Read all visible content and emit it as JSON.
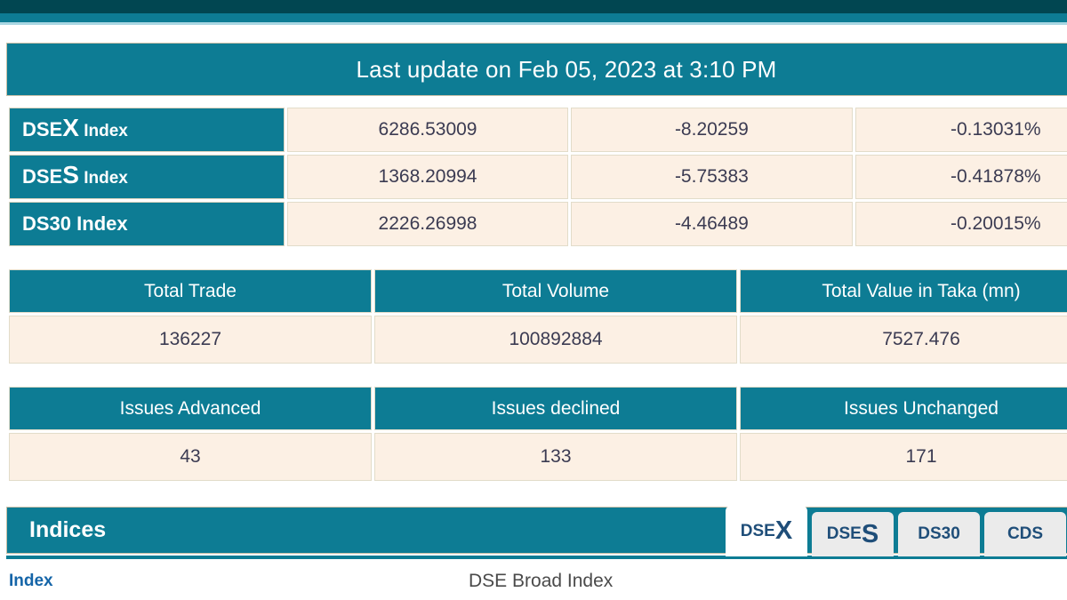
{
  "banner": {
    "last_update": "Last update on Feb 05, 2023 at 3:10 PM"
  },
  "indices": [
    {
      "prefix": "DSE",
      "emphasis": "X",
      "suffix": " Index",
      "value": "6286.53009",
      "change": "-8.20259",
      "percent": "-0.13031%"
    },
    {
      "prefix": "DSE",
      "emphasis": "S",
      "suffix": " Index",
      "value": "1368.20994",
      "change": "-5.75383",
      "percent": "-0.41878%"
    },
    {
      "prefix": "DS30 Index",
      "emphasis": "",
      "suffix": "",
      "value": "2226.26998",
      "change": "-4.46489",
      "percent": "-0.20015%"
    }
  ],
  "totals": {
    "headers": [
      "Total Trade",
      "Total Volume",
      "Total Value in Taka (mn)"
    ],
    "values": [
      "136227",
      "100892884",
      "7527.476"
    ]
  },
  "issues": {
    "headers": [
      "Issues Advanced",
      "Issues declined",
      "Issues Unchanged"
    ],
    "values": [
      "43",
      "133",
      "171"
    ]
  },
  "indices_panel": {
    "title": "Indices",
    "tabs": [
      {
        "prefix": "DSE",
        "emphasis": "X",
        "active": true
      },
      {
        "prefix": "DSE",
        "emphasis": "S",
        "active": false
      },
      {
        "prefix": "DS30",
        "emphasis": "",
        "active": false
      },
      {
        "prefix": "CDS",
        "emphasis": "",
        "active": false
      }
    ],
    "detail": {
      "key": "Index",
      "value": "DSE Broad Index"
    }
  },
  "colors": {
    "teal": "#0d7c94",
    "dark_teal": "#014651",
    "cream": "#fcf0e4",
    "tab_text": "#1f4e79",
    "link_blue": "#1565a8"
  }
}
